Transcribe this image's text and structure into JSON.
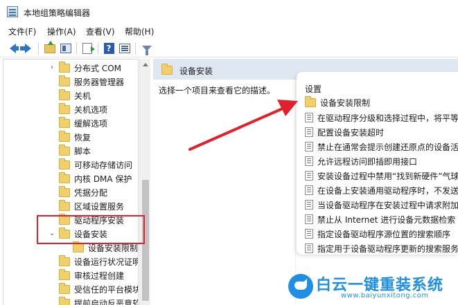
{
  "window": {
    "title": "本地组策略编辑器"
  },
  "menu": [
    "文件(F)",
    "操作(A)",
    "查看(V)",
    "帮助(H)"
  ],
  "toolbar": {
    "icons": [
      "back-icon",
      "forward-icon",
      "folder-up-icon",
      "show-hide-tree-icon",
      "export-list-icon",
      "help-icon",
      "properties-icon",
      "filter-icon"
    ]
  },
  "tree": {
    "items": [
      {
        "label": "分布式 COM",
        "expanded": false
      },
      {
        "label": "服务器管理器"
      },
      {
        "label": "关机"
      },
      {
        "label": "关机选项"
      },
      {
        "label": "缓解选项"
      },
      {
        "label": "恢复"
      },
      {
        "label": "脚本"
      },
      {
        "label": "可移动存储访问"
      },
      {
        "label": "内核 DMA 保护"
      },
      {
        "label": "凭据分配"
      },
      {
        "label": "区域设置服务"
      },
      {
        "label": "驱动程序安装"
      },
      {
        "label": "设备安装",
        "expanded": true,
        "selected": true
      },
      {
        "label": "设备安装限制",
        "child": true
      },
      {
        "label": "设备运行状况证明"
      },
      {
        "label": "审核过程创建"
      },
      {
        "label": "受信任的平台模块"
      },
      {
        "label": "提前启动反恶意软"
      }
    ]
  },
  "right_pane": {
    "header": "设备安装",
    "description": "选择一个项目来查看它的描述。",
    "settings_header": "设置",
    "settings": [
      {
        "label": "设备安装限制",
        "type": "folder"
      },
      {
        "label": "在驱动程序分级和选择过程中，将平等",
        "type": "policy"
      },
      {
        "label": "配置设备安装超时",
        "type": "policy"
      },
      {
        "label": "禁止在通常会提示创建还原点的设备活",
        "type": "policy"
      },
      {
        "label": "允许远程访问即插即用接口",
        "type": "policy"
      },
      {
        "label": "安装设备过程中禁用“找到新硬件”气球",
        "type": "policy"
      },
      {
        "label": "在设备上安装通用驱动程序时，不发送",
        "type": "policy"
      },
      {
        "label": "当设备驱动程序在安装过程中请求附加",
        "type": "policy"
      },
      {
        "label": "禁止从 Internet 进行设备元数据检索",
        "type": "policy"
      },
      {
        "label": "指定设备驱动程序源位置的搜索顺序",
        "type": "policy"
      },
      {
        "label": "指定用于设备驱动程序更新的搜索服务",
        "type": "policy"
      }
    ]
  },
  "watermark": {
    "title": "白云一键重装系统",
    "url": "www.baiyunxitong.com"
  },
  "colors": {
    "highlight": "#e0202a",
    "header_bg": "#dfe7f2",
    "brand": "#1f8fe6"
  }
}
